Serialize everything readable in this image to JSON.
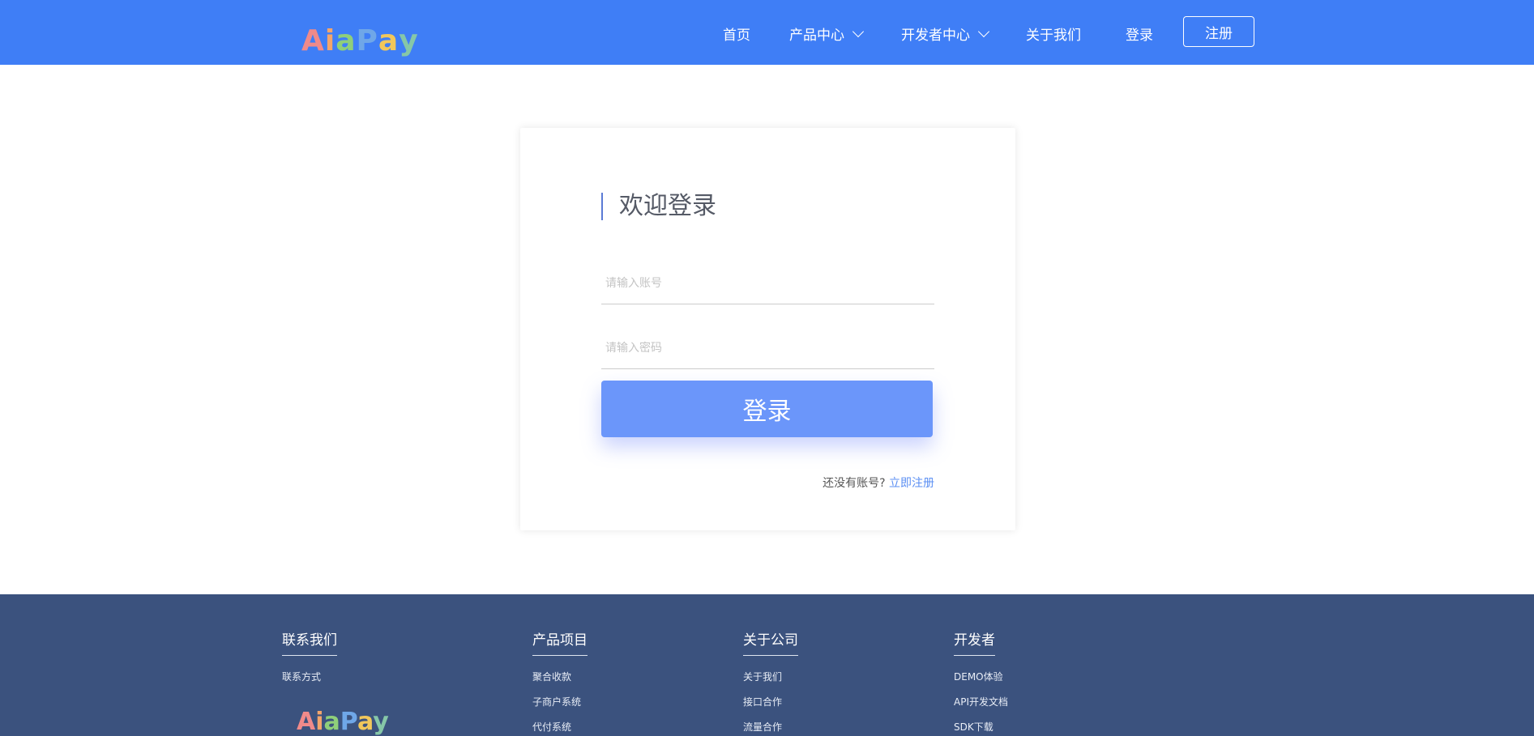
{
  "header": {
    "logo": {
      "letters": [
        "A",
        "i",
        "a",
        "P",
        "a",
        "y"
      ],
      "colors": [
        "#f08a8a",
        "#f4a56b",
        "#8fcf7a",
        "#6fa7e8",
        "#f1c75b",
        "#86c7a8"
      ]
    },
    "nav": {
      "home": "首页",
      "products": "产品中心",
      "developers": "开发者中心",
      "about": "关于我们",
      "login": "登录",
      "register": "注册"
    }
  },
  "login": {
    "title": "欢迎登录",
    "account_placeholder": "请输入账号",
    "password_placeholder": "请输入密码",
    "button": "登录",
    "no_account": "还没有账号?",
    "signup_link": "立即注册"
  },
  "footer": {
    "columns": [
      {
        "title": "联系我们",
        "links": [
          "联系方式"
        ]
      },
      {
        "title": "产品项目",
        "links": [
          "聚合收款",
          "子商户系统",
          "代付系统"
        ]
      },
      {
        "title": "关于公司",
        "links": [
          "关于我们",
          "接口合作",
          "流量合作"
        ]
      },
      {
        "title": "开发者",
        "links": [
          "DEMO体验",
          "API开发文档",
          "SDK下载"
        ]
      }
    ]
  },
  "colors": {
    "header_bg": "#3f7ef6",
    "footer_bg": "#3b527e",
    "primary_button": "#6b96fa",
    "link": "#5b8ff3"
  }
}
